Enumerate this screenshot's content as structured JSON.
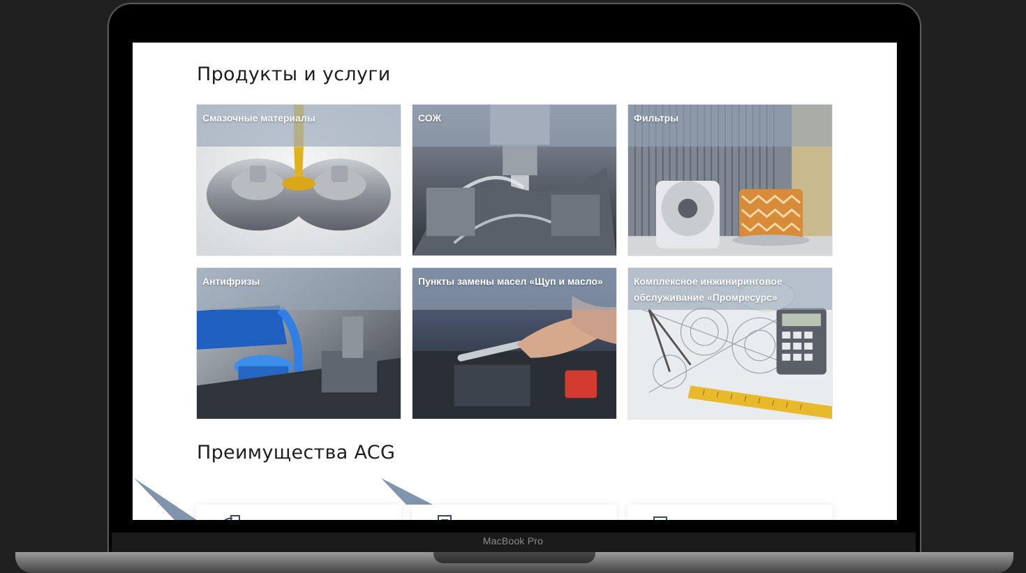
{
  "device": {
    "model_label": "MacBook Pro"
  },
  "products_section": {
    "title": "Продукты и услуги",
    "cards": [
      {
        "label": "Смазочные материалы",
        "image": "gears-oil-image"
      },
      {
        "label": "СОЖ",
        "image": "cnc-coolant-image"
      },
      {
        "label": "Фильтры",
        "image": "filters-image"
      },
      {
        "label": "Антифризы",
        "image": "antifreeze-image"
      },
      {
        "label": "Пункты замены масел «Щуп и масло»",
        "image": "engine-repair-image"
      },
      {
        "label": "Комплексное инжиниринговое обслуживание «Промресурс»",
        "image": "blueprint-image"
      }
    ]
  },
  "advantages_section": {
    "title": "Преимущества ACG",
    "cards": [
      {
        "icon": "document-icon"
      },
      {
        "icon": "document-icon"
      },
      {
        "icon": "document-icon"
      }
    ]
  },
  "colors": {
    "overlay": "#96a4b6",
    "title_text": "#1e1e1e",
    "background": "#202020"
  }
}
